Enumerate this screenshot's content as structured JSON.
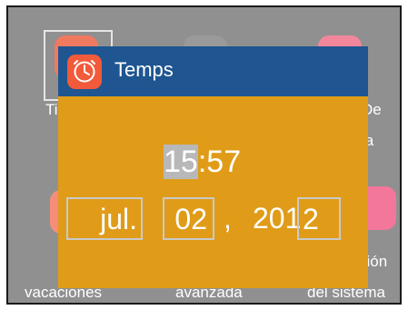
{
  "background": {
    "tiles": [
      {
        "label_top": "Tie",
        "label_bottom": "",
        "color": "#f07a60"
      },
      {
        "label_top": "",
        "label_bottom": "",
        "color": "#9a9a9a"
      },
      {
        "label_top": "De",
        "label_bottom": "la",
        "color": "#f2879b"
      },
      {
        "label_top": "",
        "label_bottom": "vacaciones",
        "color": "#f58e78"
      },
      {
        "label_top": "",
        "label_bottom": "avanzada",
        "color": "#9a9a9a"
      },
      {
        "label_top": "ción",
        "label_bottom": "del sistema",
        "color": "#f2779b"
      }
    ]
  },
  "dialog": {
    "title": "Temps",
    "icon": "clock-icon",
    "time": {
      "hours": "15",
      "separator": ":",
      "minutes": "57"
    },
    "date": {
      "month": "jul.",
      "day": "02",
      "comma": ",",
      "year_prefix": "201",
      "year_last": "2"
    }
  },
  "colors": {
    "title_bar": "#1f5591",
    "dialog_background": "#e09c18",
    "selection": "#b8b8b8",
    "app_icon": "#f15a3a"
  }
}
